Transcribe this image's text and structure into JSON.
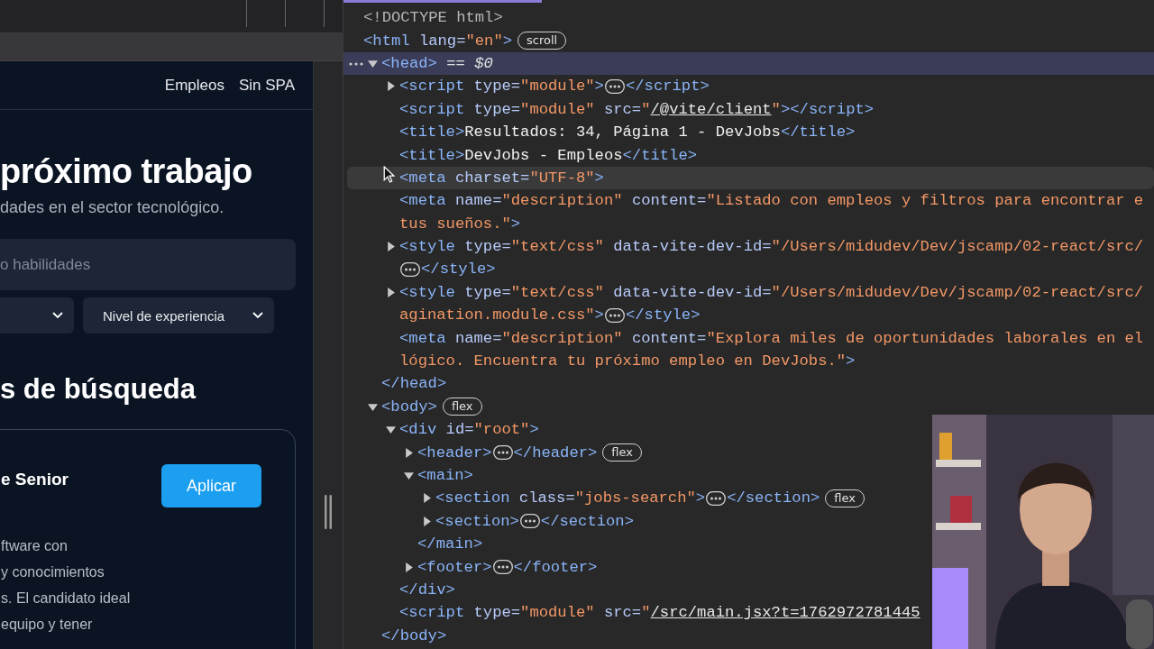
{
  "page": {
    "nav_links": [
      "Empleos",
      "Sin SPA"
    ],
    "hero_title": "próximo trabajo",
    "hero_subtitle": "dades en el sector tecnológico.",
    "search": {
      "placeholder": "o habilidades"
    },
    "filter_label": "Nivel de experiencia",
    "section_title": "s de búsqueda",
    "job": {
      "title": "e Senior",
      "apply_button": "Aplicar",
      "description": "ftware con\n y conocimientos\ns. El candidato ideal\n equipo y tener"
    }
  },
  "elements_tree": [
    {
      "selected": false,
      "hovered": false,
      "lines": [
        [
          {
            "kind": "muted",
            "text": "<!DOCTYPE html>"
          }
        ]
      ]
    },
    {
      "selected": false,
      "hovered": false,
      "lines": [
        [
          {
            "kind": "tag",
            "text": "<html"
          },
          {
            "kind": "attr",
            "text": " lang="
          },
          {
            "kind": "value",
            "text": "\"en\""
          },
          {
            "kind": "tag",
            "text": ">"
          },
          {
            "kind": "badge",
            "text": "scroll"
          }
        ]
      ],
      "children": [
        {
          "expanded": true,
          "selected": true,
          "hovered": false,
          "lines": [
            [
              {
                "kind": "tag",
                "text": "<head>"
              },
              {
                "kind": "ref",
                "text": " == $0"
              }
            ]
          ],
          "children": [
            {
              "expanded": false,
              "selected": false,
              "hovered": false,
              "lines": [
                [
                  {
                    "kind": "tag",
                    "text": "<script"
                  },
                  {
                    "kind": "attr",
                    "text": " type="
                  },
                  {
                    "kind": "value",
                    "text": "\"module\""
                  },
                  {
                    "kind": "tag",
                    "text": ">"
                  },
                  {
                    "kind": "ellipsis"
                  },
                  {
                    "kind": "tag",
                    "text": "</script>"
                  }
                ]
              ]
            },
            {
              "selected": false,
              "hovered": false,
              "lines": [
                [
                  {
                    "kind": "tag",
                    "text": "<script"
                  },
                  {
                    "kind": "attr",
                    "text": " type="
                  },
                  {
                    "kind": "value",
                    "text": "\"module\""
                  },
                  {
                    "kind": "attr",
                    "text": " src="
                  },
                  {
                    "kind": "value",
                    "text": "\""
                  },
                  {
                    "kind": "link",
                    "text": "/@vite/client"
                  },
                  {
                    "kind": "value",
                    "text": "\""
                  },
                  {
                    "kind": "tag",
                    "text": "></script>"
                  }
                ]
              ]
            },
            {
              "selected": false,
              "hovered": false,
              "lines": [
                [
                  {
                    "kind": "tag",
                    "text": "<title>"
                  },
                  {
                    "kind": "text",
                    "text": "Resultados: 34, Página 1 - DevJobs"
                  },
                  {
                    "kind": "tag",
                    "text": "</title>"
                  }
                ]
              ]
            },
            {
              "selected": false,
              "hovered": false,
              "lines": [
                [
                  {
                    "kind": "tag",
                    "text": "<title>"
                  },
                  {
                    "kind": "text",
                    "text": "DevJobs - Empleos"
                  },
                  {
                    "kind": "tag",
                    "text": "</title>"
                  }
                ]
              ]
            },
            {
              "selected": false,
              "hovered": true,
              "lines": [
                [
                  {
                    "kind": "tag",
                    "text": "<meta"
                  },
                  {
                    "kind": "attr",
                    "text": " charset="
                  },
                  {
                    "kind": "value",
                    "text": "\"UTF-8\""
                  },
                  {
                    "kind": "tag",
                    "text": ">"
                  }
                ]
              ]
            },
            {
              "selected": false,
              "hovered": false,
              "lines": [
                [
                  {
                    "kind": "tag",
                    "text": "<meta"
                  },
                  {
                    "kind": "attr",
                    "text": " name="
                  },
                  {
                    "kind": "value",
                    "text": "\"description\""
                  },
                  {
                    "kind": "attr",
                    "text": " content="
                  },
                  {
                    "kind": "value",
                    "text": "\"Listado con empleos y filtros para encontrar e"
                  }
                ],
                [
                  {
                    "kind": "value",
                    "text": "tus sueños.\""
                  },
                  {
                    "kind": "tag",
                    "text": ">"
                  }
                ]
              ]
            },
            {
              "expanded": false,
              "selected": false,
              "hovered": false,
              "lines": [
                [
                  {
                    "kind": "tag",
                    "text": "<style"
                  },
                  {
                    "kind": "attr",
                    "text": " type="
                  },
                  {
                    "kind": "value",
                    "text": "\"text/css\""
                  },
                  {
                    "kind": "attr",
                    "text": " data-vite-dev-id="
                  },
                  {
                    "kind": "value",
                    "text": "\"/Users/midudev/Dev/jscamp/02-react/src/"
                  }
                ],
                [
                  {
                    "kind": "ellipsis"
                  },
                  {
                    "kind": "tag",
                    "text": "</style>"
                  }
                ]
              ]
            },
            {
              "expanded": false,
              "selected": false,
              "hovered": false,
              "lines": [
                [
                  {
                    "kind": "tag",
                    "text": "<style"
                  },
                  {
                    "kind": "attr",
                    "text": " type="
                  },
                  {
                    "kind": "value",
                    "text": "\"text/css\""
                  },
                  {
                    "kind": "attr",
                    "text": " data-vite-dev-id="
                  },
                  {
                    "kind": "value",
                    "text": "\"/Users/midudev/Dev/jscamp/02-react/src/"
                  }
                ],
                [
                  {
                    "kind": "value",
                    "text": "agination.module.css\""
                  },
                  {
                    "kind": "tag",
                    "text": ">"
                  },
                  {
                    "kind": "ellipsis"
                  },
                  {
                    "kind": "tag",
                    "text": "</style>"
                  }
                ]
              ]
            },
            {
              "selected": false,
              "hovered": false,
              "lines": [
                [
                  {
                    "kind": "tag",
                    "text": "<meta"
                  },
                  {
                    "kind": "attr",
                    "text": " name="
                  },
                  {
                    "kind": "value",
                    "text": "\"description\""
                  },
                  {
                    "kind": "attr",
                    "text": " content="
                  },
                  {
                    "kind": "value",
                    "text": "\"Explora miles de oportunidades laborales en el"
                  }
                ],
                [
                  {
                    "kind": "value",
                    "text": "lógico. Encuentra tu próximo empleo en DevJobs.\""
                  },
                  {
                    "kind": "tag",
                    "text": ">"
                  }
                ]
              ]
            }
          ],
          "close": [
            {
              "kind": "tag",
              "text": "</head>"
            }
          ]
        },
        {
          "expanded": true,
          "selected": false,
          "hovered": false,
          "lines": [
            [
              {
                "kind": "tag",
                "text": "<body>"
              },
              {
                "kind": "badge",
                "text": "flex"
              }
            ]
          ],
          "children": [
            {
              "expanded": true,
              "selected": false,
              "hovered": false,
              "lines": [
                [
                  {
                    "kind": "tag",
                    "text": "<div"
                  },
                  {
                    "kind": "attr",
                    "text": " id="
                  },
                  {
                    "kind": "value",
                    "text": "\"root\""
                  },
                  {
                    "kind": "tag",
                    "text": ">"
                  }
                ]
              ],
              "children": [
                {
                  "expanded": false,
                  "selected": false,
                  "hovered": false,
                  "lines": [
                    [
                      {
                        "kind": "tag",
                        "text": "<header>"
                      },
                      {
                        "kind": "ellipsis"
                      },
                      {
                        "kind": "tag",
                        "text": "</header>"
                      },
                      {
                        "kind": "badge",
                        "text": "flex"
                      }
                    ]
                  ]
                },
                {
                  "expanded": true,
                  "selected": false,
                  "hovered": false,
                  "lines": [
                    [
                      {
                        "kind": "tag",
                        "text": "<main>"
                      }
                    ]
                  ],
                  "children": [
                    {
                      "expanded": false,
                      "selected": false,
                      "hovered": false,
                      "lines": [
                        [
                          {
                            "kind": "tag",
                            "text": "<section"
                          },
                          {
                            "kind": "attr",
                            "text": " class="
                          },
                          {
                            "kind": "value",
                            "text": "\"jobs-search\""
                          },
                          {
                            "kind": "tag",
                            "text": ">"
                          },
                          {
                            "kind": "ellipsis"
                          },
                          {
                            "kind": "tag",
                            "text": "</section>"
                          },
                          {
                            "kind": "badge",
                            "text": "flex"
                          }
                        ]
                      ]
                    },
                    {
                      "expanded": false,
                      "selected": false,
                      "hovered": false,
                      "lines": [
                        [
                          {
                            "kind": "tag",
                            "text": "<section>"
                          },
                          {
                            "kind": "ellipsis"
                          },
                          {
                            "kind": "tag",
                            "text": "</section>"
                          }
                        ]
                      ]
                    }
                  ],
                  "close": [
                    {
                      "kind": "tag",
                      "text": "</main>"
                    }
                  ]
                },
                {
                  "expanded": false,
                  "selected": false,
                  "hovered": false,
                  "lines": [
                    [
                      {
                        "kind": "tag",
                        "text": "<footer>"
                      },
                      {
                        "kind": "ellipsis"
                      },
                      {
                        "kind": "tag",
                        "text": "</footer>"
                      }
                    ]
                  ]
                }
              ],
              "close": [
                {
                  "kind": "tag",
                  "text": "</div>"
                }
              ]
            },
            {
              "selected": false,
              "hovered": false,
              "lines": [
                [
                  {
                    "kind": "tag",
                    "text": "<script"
                  },
                  {
                    "kind": "attr",
                    "text": " type="
                  },
                  {
                    "kind": "value",
                    "text": "\"module\""
                  },
                  {
                    "kind": "attr",
                    "text": " src="
                  },
                  {
                    "kind": "value",
                    "text": "\""
                  },
                  {
                    "kind": "link",
                    "text": "/src/main.jsx?t=1762972781445"
                  }
                ]
              ]
            }
          ],
          "close": [
            {
              "kind": "tag",
              "text": "</body>"
            }
          ]
        }
      ]
    }
  ]
}
